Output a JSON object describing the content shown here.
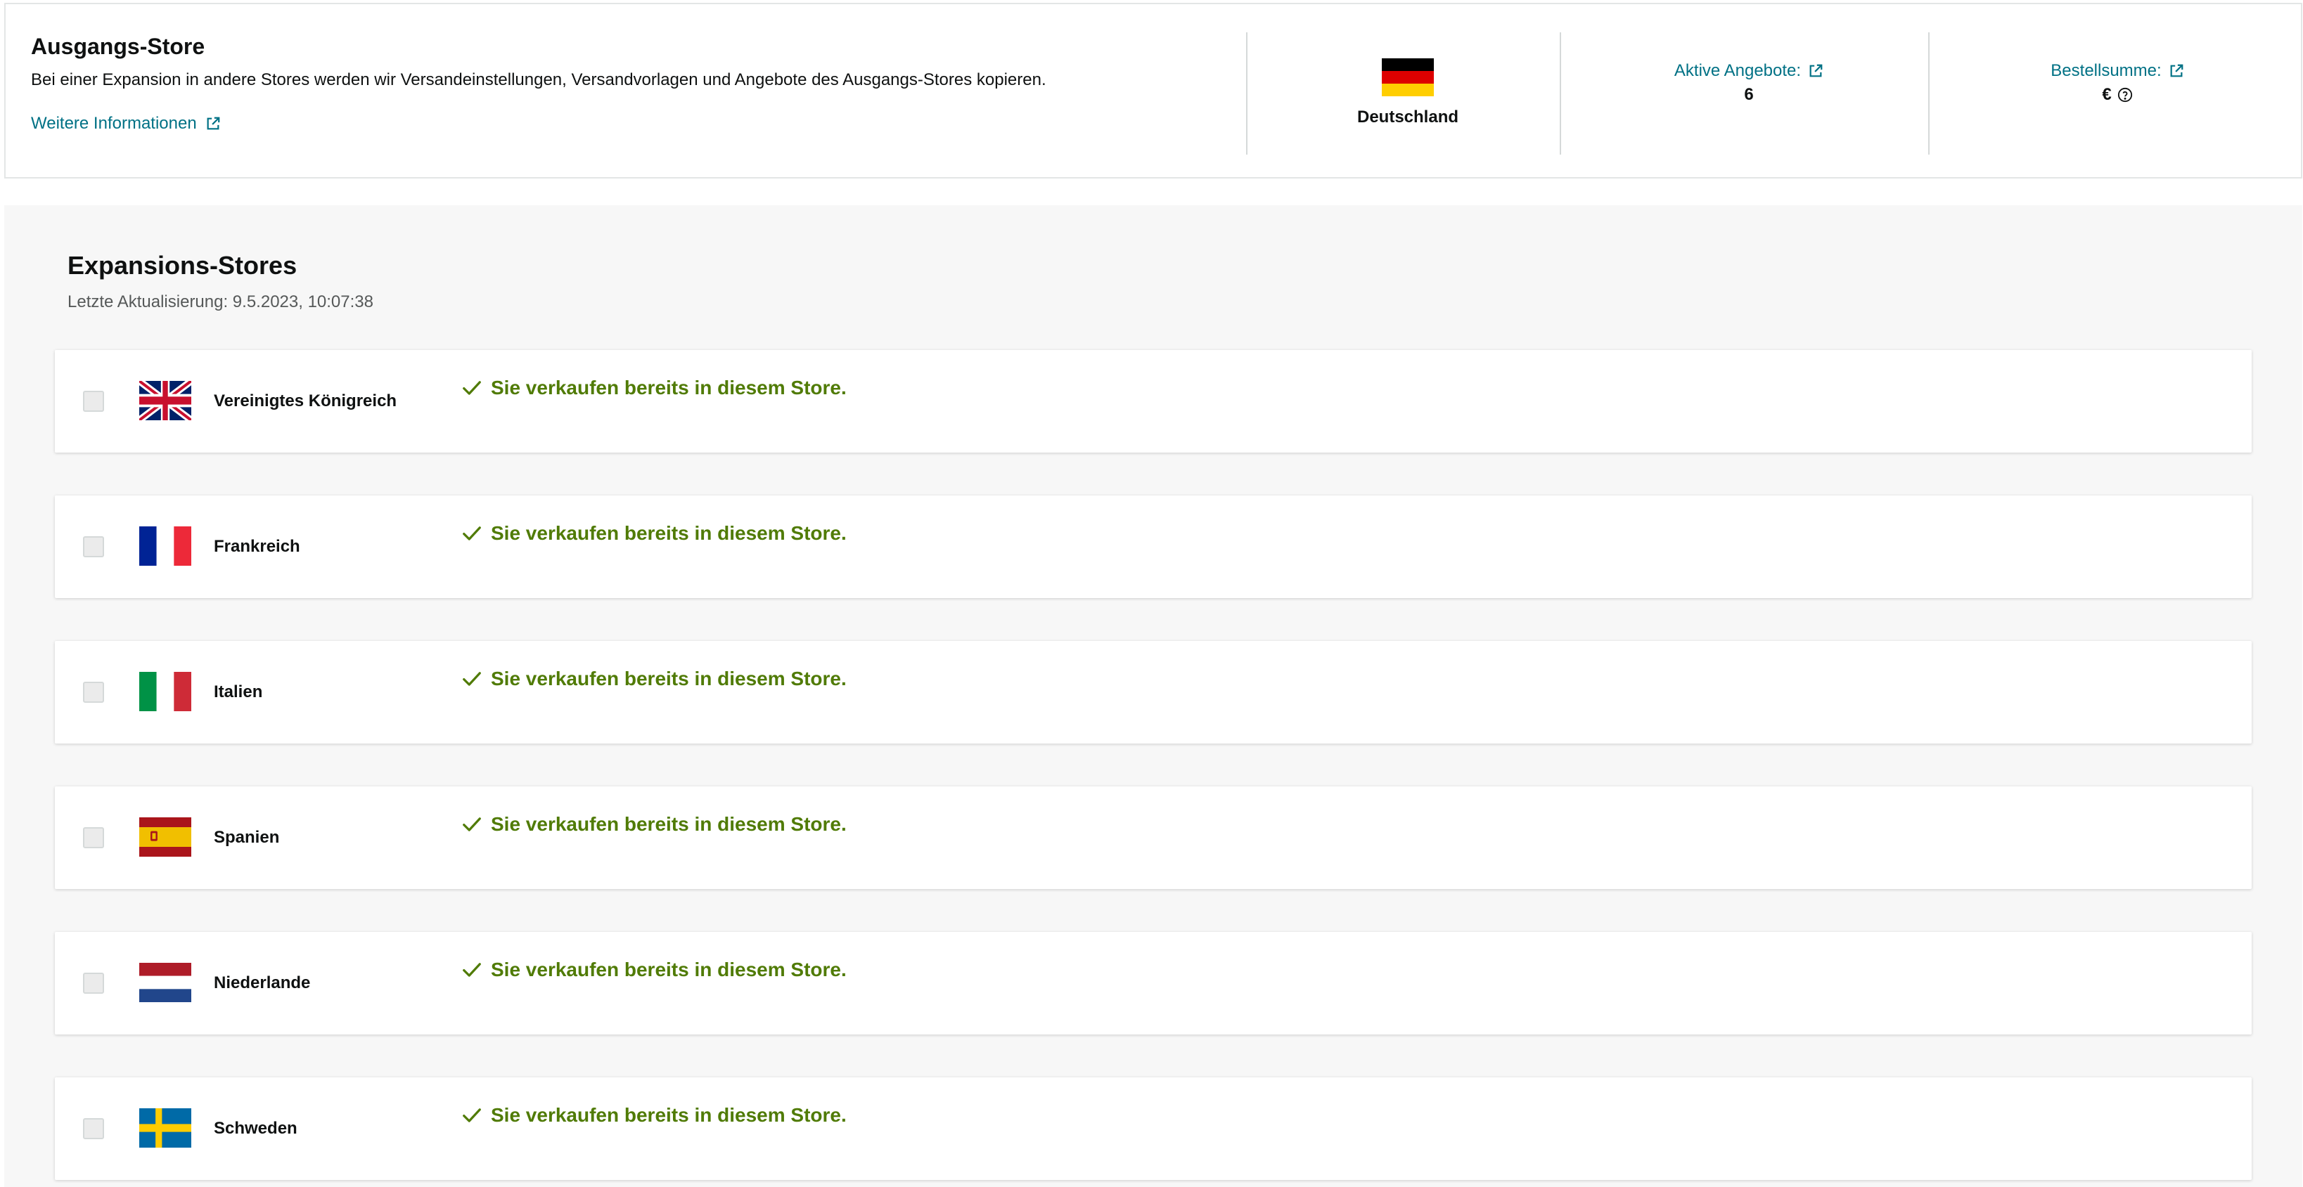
{
  "source_store": {
    "title": "Ausgangs-Store",
    "description": "Bei einer Expansion in andere Stores werden wir Versandeinstellungen, Versandvorlagen und Angebote des Ausgangs-Stores kopieren.",
    "more_info_label": "Weitere Informationen",
    "country": "Deutschland",
    "country_flag": "flag-germany",
    "active_offers_label": "Aktive Angebote:",
    "active_offers_value": "6",
    "order_total_label": "Bestellsumme:",
    "order_total_value": "€"
  },
  "expansion": {
    "title": "Expansions-Stores",
    "last_updated": "Letzte Aktualisierung: 9.5.2023, 10:07:38",
    "stores": [
      {
        "name": "Vereinigtes Königreich",
        "flag": "flag-uk",
        "status": "Sie verkaufen bereits in diesem Store.",
        "checked": false
      },
      {
        "name": "Frankreich",
        "flag": "flag-france",
        "status": "Sie verkaufen bereits in diesem Store.",
        "checked": false
      },
      {
        "name": "Italien",
        "flag": "flag-italy",
        "status": "Sie verkaufen bereits in diesem Store.",
        "checked": false
      },
      {
        "name": "Spanien",
        "flag": "flag-spain",
        "status": "Sie verkaufen bereits in diesem Store.",
        "checked": false
      },
      {
        "name": "Niederlande",
        "flag": "flag-netherlands",
        "status": "Sie verkaufen bereits in diesem Store.",
        "checked": false
      },
      {
        "name": "Schweden",
        "flag": "flag-sweden",
        "status": "Sie verkaufen bereits in diesem Store.",
        "checked": false
      }
    ]
  },
  "colors": {
    "link": "#007185",
    "success": "#507b06",
    "panel_background": "#f7f7f7"
  }
}
